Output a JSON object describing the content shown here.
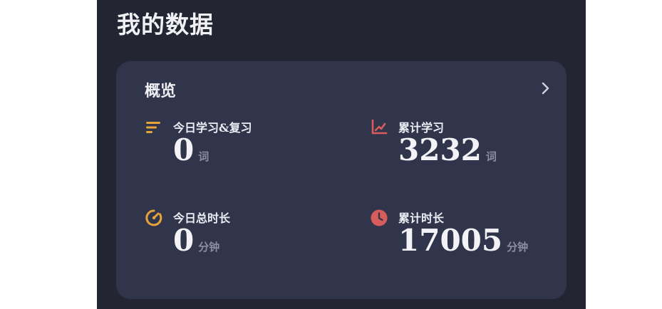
{
  "page": {
    "title": "我的数据"
  },
  "overview": {
    "title": "概览",
    "stats": [
      {
        "label": "今日学习&复习",
        "value": "0",
        "unit": "词",
        "icon": "list-lines-icon",
        "icon_color": "#e4a43a"
      },
      {
        "label": "累计学习",
        "value": "3232",
        "unit": "词",
        "icon": "trend-chart-icon",
        "icon_color": "#d95c5c"
      },
      {
        "label": "今日总时长",
        "value": "0",
        "unit": "分钟",
        "icon": "gauge-icon",
        "icon_color": "#e4a43a"
      },
      {
        "label": "累计时长",
        "value": "17005",
        "unit": "分钟",
        "icon": "clock-icon",
        "icon_color": "#d95c5c"
      }
    ]
  },
  "colors": {
    "background": "#232532",
    "card": "#31354b",
    "accent_orange": "#e4a43a",
    "accent_red": "#d95c5c"
  }
}
